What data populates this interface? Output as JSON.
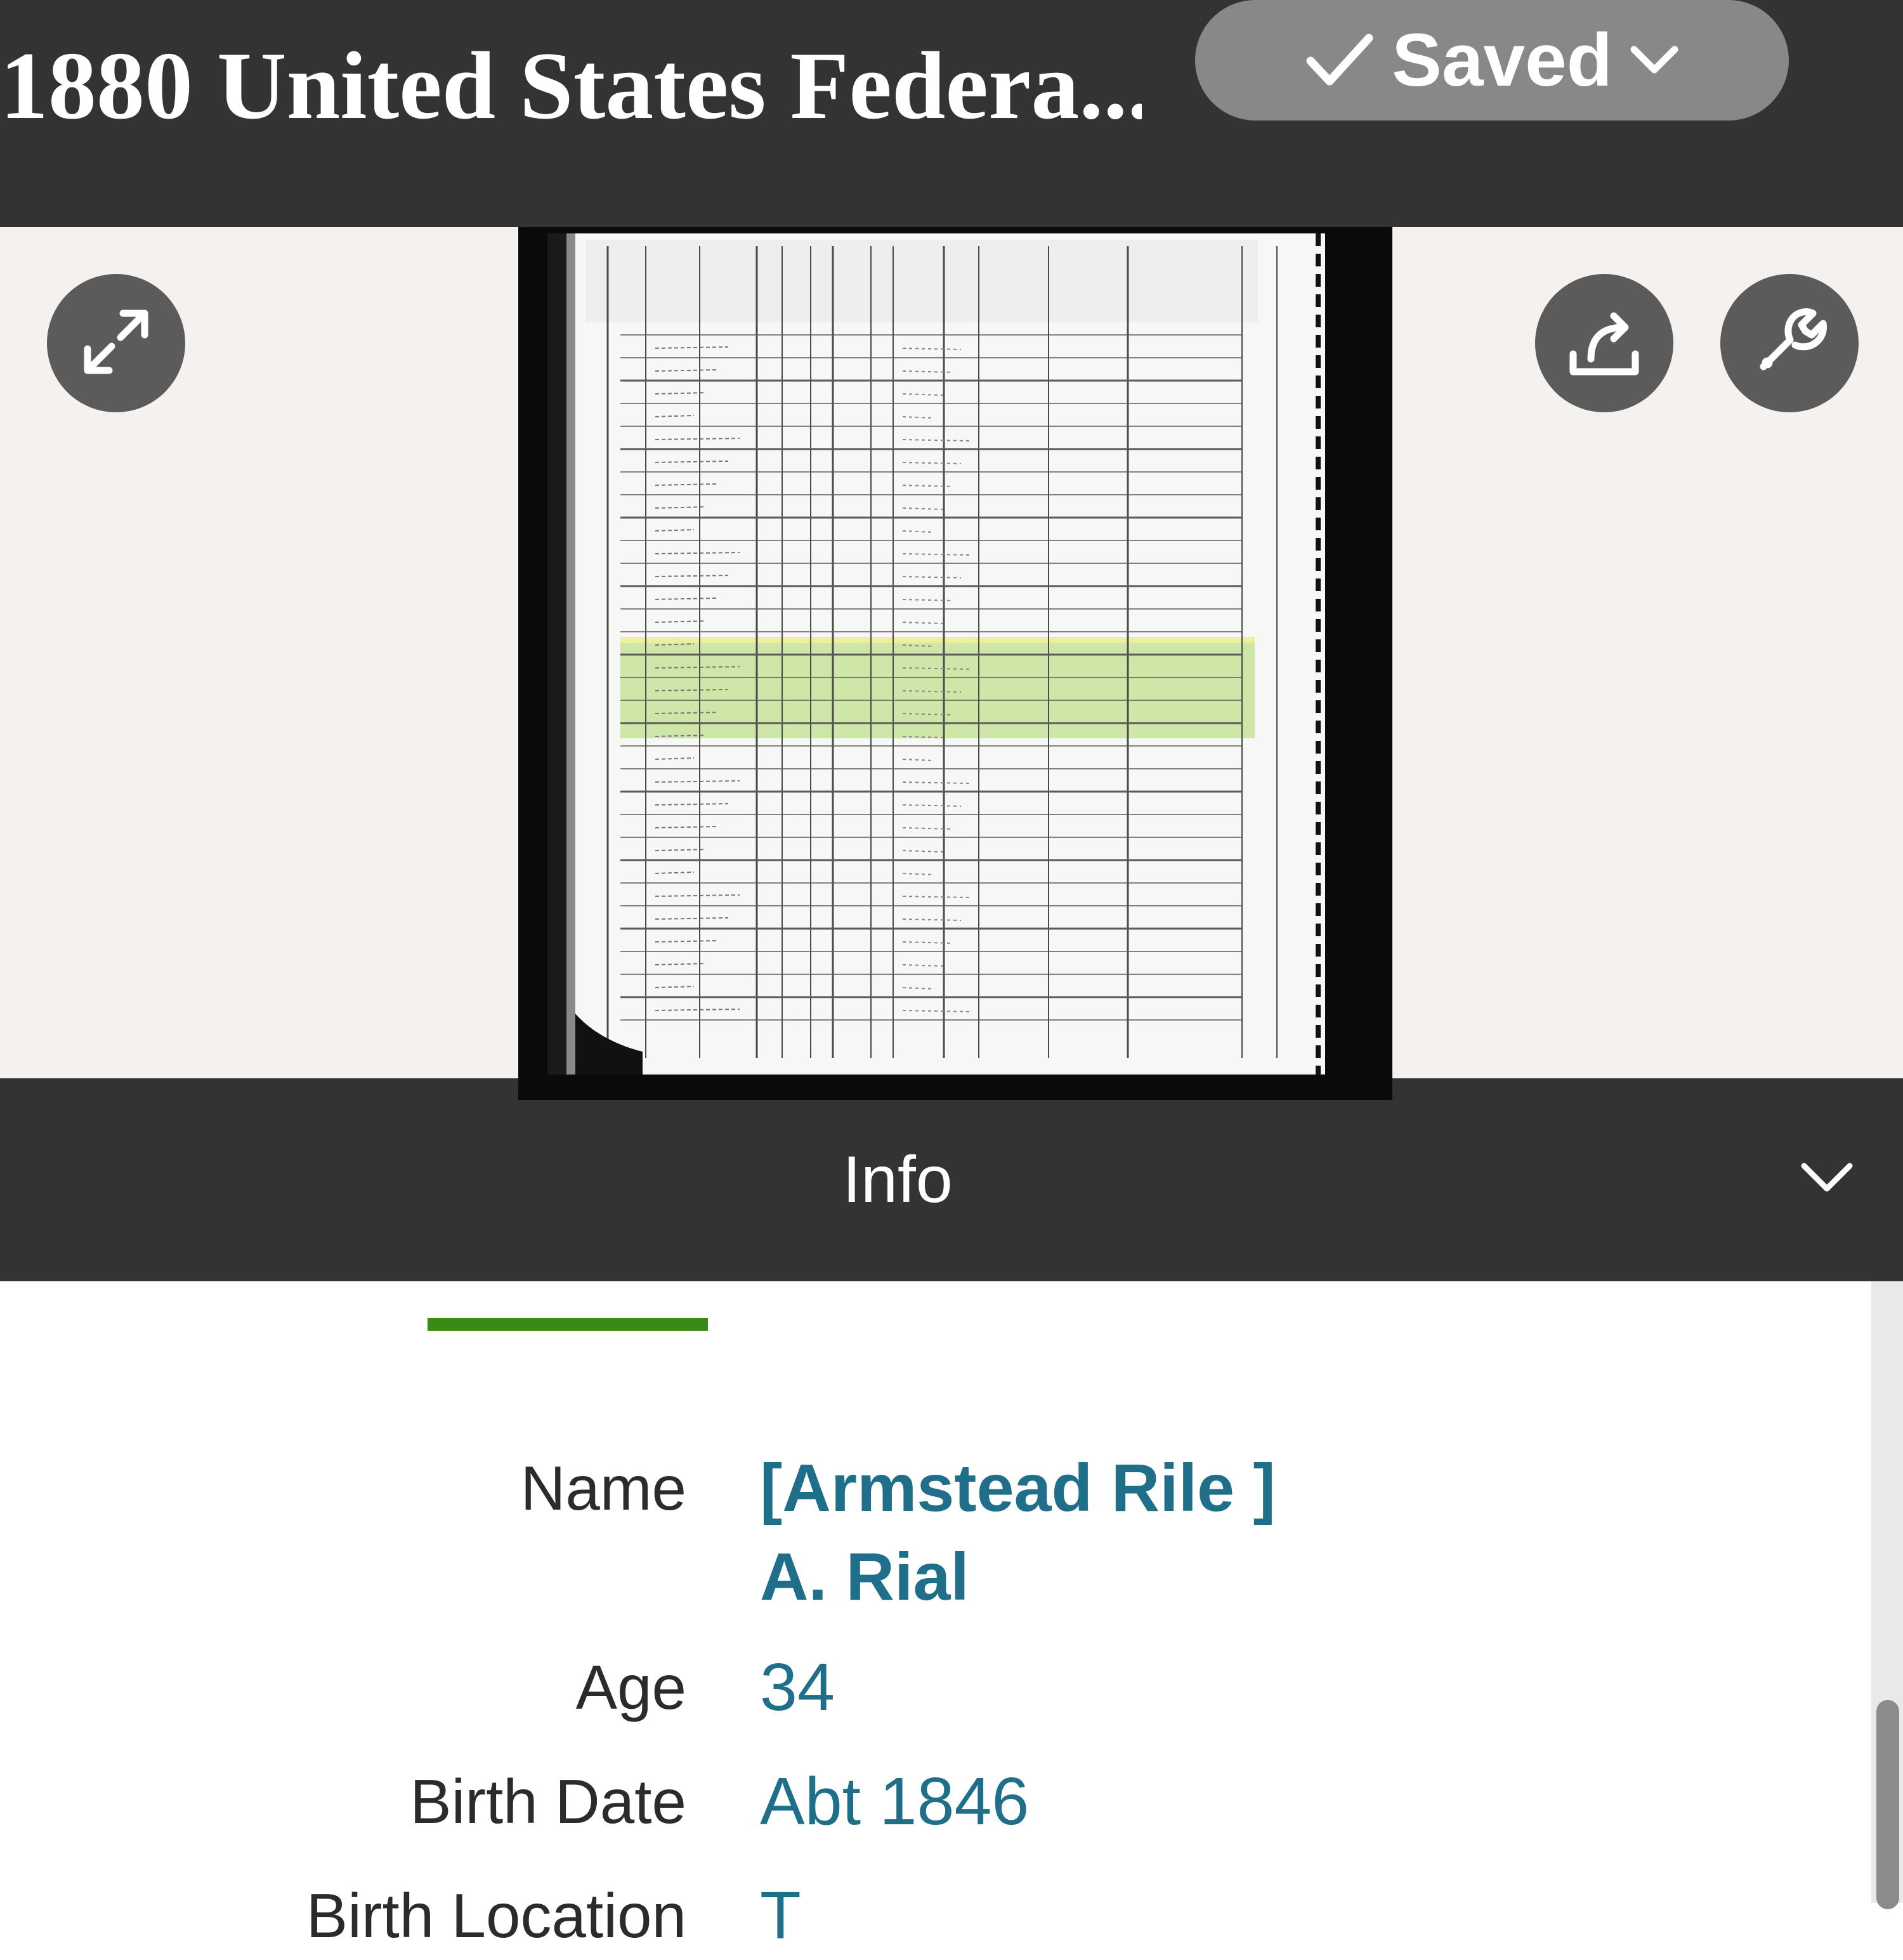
{
  "header": {
    "title": "1880 United States Federa...",
    "saved_label": "Saved"
  },
  "viewer": {
    "icons": {
      "expand": "expand-arrows-icon",
      "share": "share-icon",
      "tools": "wrench-icon"
    },
    "highlight_color": "#c9e3a0"
  },
  "info_bar": {
    "label": "Info",
    "toggle_icon": "chevron-down-icon"
  },
  "details": {
    "fields": [
      {
        "label": "Name",
        "value_line1": "[Armstead Rile ]",
        "value_line2": "A. Rial"
      },
      {
        "label": "Age",
        "value": "34"
      },
      {
        "label": "Birth Date",
        "value": "Abt 1846"
      },
      {
        "label": "Birth Location",
        "value": "T"
      }
    ]
  },
  "colors": {
    "header_bg": "#333333",
    "link": "#1f6f8b",
    "accent_green": "#3a8a17",
    "saved_pill": "#888888",
    "viewer_bg": "#f4f1ee"
  }
}
